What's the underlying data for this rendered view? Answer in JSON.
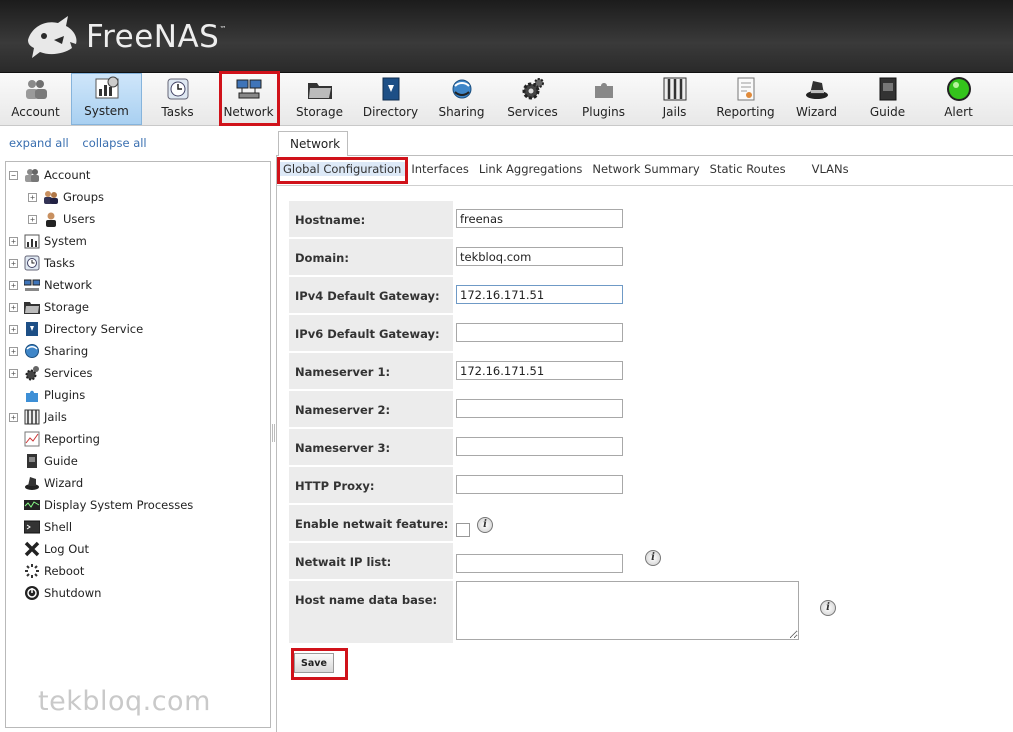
{
  "app": {
    "title": "FreeNAS"
  },
  "toolbar": {
    "items": [
      {
        "label": "Account",
        "icon": "users-icon"
      },
      {
        "label": "System",
        "icon": "system-chart-icon"
      },
      {
        "label": "Tasks",
        "icon": "clock-icon"
      },
      {
        "label": "Network",
        "icon": "network-icon"
      },
      {
        "label": "Storage",
        "icon": "storage-folder-icon"
      },
      {
        "label": "Directory",
        "icon": "directory-book-icon"
      },
      {
        "label": "Sharing",
        "icon": "sharing-globe-icon"
      },
      {
        "label": "Services",
        "icon": "services-gears-icon"
      },
      {
        "label": "Plugins",
        "icon": "plugins-puzzle-icon"
      },
      {
        "label": "Jails",
        "icon": "jails-bars-icon"
      },
      {
        "label": "Reporting",
        "icon": "reporting-document-icon"
      },
      {
        "label": "Wizard",
        "icon": "wizard-hat-icon"
      },
      {
        "label": "Guide",
        "icon": "guide-book-icon"
      },
      {
        "label": "Alert",
        "icon": "alert-green-light-icon"
      }
    ],
    "active": "System"
  },
  "sidebar": {
    "expand_all": "expand all",
    "collapse_all": "collapse all",
    "items": [
      {
        "label": "Account",
        "expander": "−",
        "indent": 0
      },
      {
        "label": "Groups",
        "expander": "+",
        "indent": 1
      },
      {
        "label": "Users",
        "expander": "+",
        "indent": 1
      },
      {
        "label": "System",
        "expander": "+",
        "indent": 0
      },
      {
        "label": "Tasks",
        "expander": "+",
        "indent": 0
      },
      {
        "label": "Network",
        "expander": "+",
        "indent": 0
      },
      {
        "label": "Storage",
        "expander": "+",
        "indent": 0
      },
      {
        "label": "Directory Service",
        "expander": "+",
        "indent": 0
      },
      {
        "label": "Sharing",
        "expander": "+",
        "indent": 0
      },
      {
        "label": "Services",
        "expander": "+",
        "indent": 0
      },
      {
        "label": "Plugins",
        "expander": "",
        "indent": 0
      },
      {
        "label": "Jails",
        "expander": "+",
        "indent": 0
      },
      {
        "label": "Reporting",
        "expander": "",
        "indent": 0
      },
      {
        "label": "Guide",
        "expander": "",
        "indent": 0
      },
      {
        "label": "Wizard",
        "expander": "",
        "indent": 0
      },
      {
        "label": "Display System Processes",
        "expander": "",
        "indent": 0
      },
      {
        "label": "Shell",
        "expander": "",
        "indent": 0
      },
      {
        "label": "Log Out",
        "expander": "",
        "indent": 0
      },
      {
        "label": "Reboot",
        "expander": "",
        "indent": 0
      },
      {
        "label": "Shutdown",
        "expander": "",
        "indent": 0
      }
    ]
  },
  "watermark": "tekbloq.com",
  "main": {
    "tab": "Network",
    "subtabs": [
      "Global Configuration",
      "Interfaces",
      "Link Aggregations",
      "Network Summary",
      "Static Routes",
      "VLANs"
    ],
    "active_subtab": "Global Configuration",
    "form": {
      "hostname": {
        "label": "Hostname:",
        "value": "freenas"
      },
      "domain": {
        "label": "Domain:",
        "value": "tekbloq.com"
      },
      "ipv4_gateway": {
        "label": "IPv4 Default Gateway:",
        "value": "172.16.171.51"
      },
      "ipv6_gateway": {
        "label": "IPv6 Default Gateway:",
        "value": ""
      },
      "nameserver1": {
        "label": "Nameserver 1:",
        "value": "172.16.171.51"
      },
      "nameserver2": {
        "label": "Nameserver 2:",
        "value": ""
      },
      "nameserver3": {
        "label": "Nameserver 3:",
        "value": ""
      },
      "http_proxy": {
        "label": "HTTP Proxy:",
        "value": ""
      },
      "netwait_enable": {
        "label": "Enable netwait feature:",
        "checked": false
      },
      "netwait_ips": {
        "label": "Netwait IP list:",
        "value": ""
      },
      "hosts_db": {
        "label": "Host name data base:",
        "value": ""
      }
    },
    "save_label": "Save",
    "info_glyph": "i"
  },
  "colors": {
    "highlight": "#d0121a",
    "active_tab": "#a9d0f1"
  }
}
